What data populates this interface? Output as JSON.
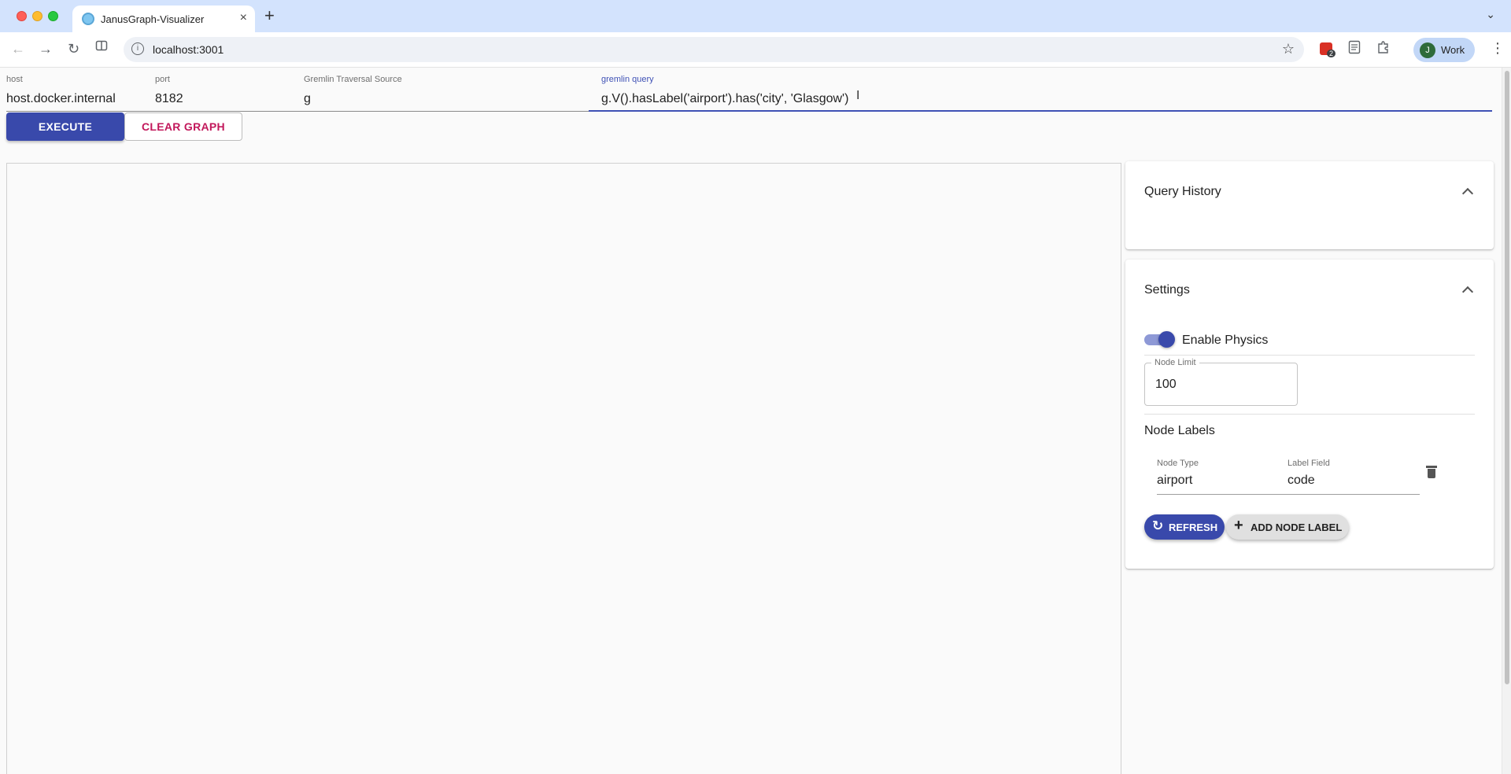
{
  "browser": {
    "tab_title": "JanusGraph-Visualizer",
    "tab_close": "×",
    "new_tab": "+",
    "url": "localhost:3001",
    "profile_initial": "J",
    "profile_name": "Work",
    "extension_badge": "2",
    "icons": {
      "back": "←",
      "forward": "→",
      "reload": "↻",
      "site_info": "i",
      "bookmark": "☆",
      "menu": "⋮",
      "tab_search": "⌄"
    }
  },
  "connection": {
    "host_label": "host",
    "host_value": "host.docker.internal",
    "port_label": "port",
    "port_value": "8182",
    "source_label": "Gremlin Traversal Source",
    "source_value": "g",
    "query_label": "gremlin query",
    "query_value": "g.V().hasLabel('airport').has('city', 'Glasgow')"
  },
  "actions": {
    "execute_label": "EXECUTE",
    "clear_label": "CLEAR GRAPH"
  },
  "query_history": {
    "title": "Query History"
  },
  "settings": {
    "title": "Settings",
    "physics_label": "Enable Physics",
    "physics_enabled": true,
    "node_limit_label": "Node Limit",
    "node_limit_value": "100",
    "node_labels_title": "Node Labels",
    "node_labels": [
      {
        "type_label": "Node Type",
        "type_value": "airport",
        "field_label": "Label Field",
        "field_value": "code"
      }
    ],
    "refresh_label": "REFRESH",
    "add_label": "ADD NODE LABEL",
    "icons": {
      "refresh": "↻",
      "add": "+"
    }
  },
  "colors": {
    "primary": "#3949ab",
    "secondary": "#c2185b"
  }
}
